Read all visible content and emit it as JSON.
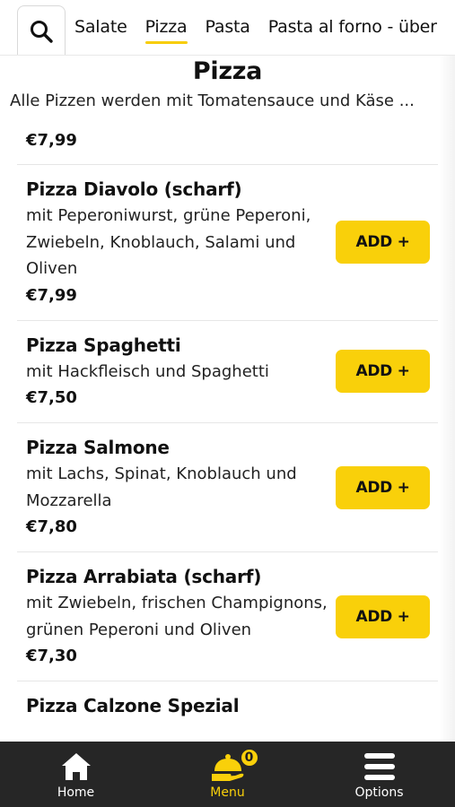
{
  "categories": {
    "search_icon": "search-icon",
    "tabs": [
      {
        "label": "Salate"
      },
      {
        "label": "Pizza",
        "active": true
      },
      {
        "label": "Pasta"
      },
      {
        "label": "Pasta al forno - über"
      }
    ]
  },
  "section": {
    "title": "Pizza",
    "description": "Alle Pizzen werden mit Tomatensauce und Käse ..."
  },
  "items": [
    {
      "name": "",
      "description": "",
      "price": "€7,99"
    },
    {
      "name": "Pizza Diavolo (scharf)",
      "description": "mit Peperoniwurst, grüne Peperoni, Zwiebeln, Knoblauch, Salami und Oliven",
      "price": "€7,99",
      "button": "ADD +"
    },
    {
      "name": "Pizza Spaghetti",
      "description": "mit Hackfleisch und Spaghetti",
      "price": "€7,50",
      "button": "ADD +"
    },
    {
      "name": "Pizza Salmone",
      "description": "mit Lachs, Spinat, Knoblauch und Mozzarella",
      "price": "€7,80",
      "button": "ADD +"
    },
    {
      "name": "Pizza Arrabiata (scharf)",
      "description": "mit Zwiebeln, frischen Champignons, grünen Peperoni und Oliven",
      "price": "€7,30",
      "button": "ADD +"
    },
    {
      "name": "Pizza Calzone Spezial",
      "description": "",
      "price": "",
      "button": ""
    }
  ],
  "nav": {
    "home": "Home",
    "menu": "Menu",
    "options": "Options",
    "cart_count": "0"
  },
  "colors": {
    "accent": "#f9d00a",
    "nav_bg": "#262626"
  }
}
